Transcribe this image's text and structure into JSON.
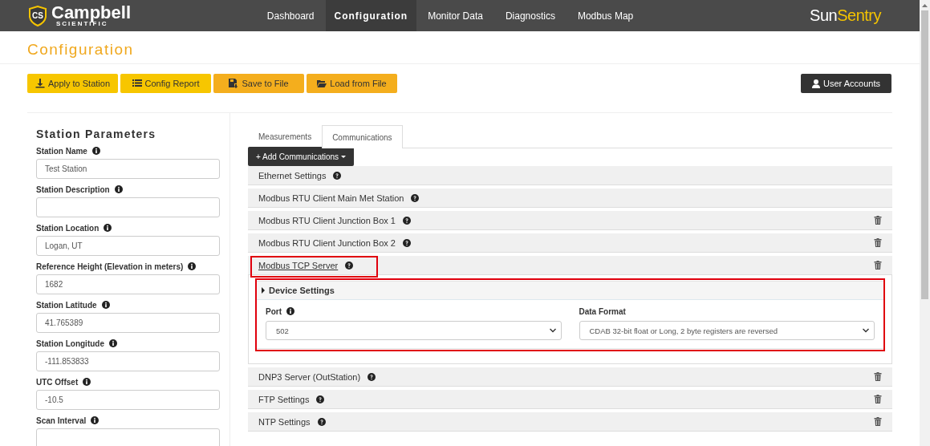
{
  "nav": {
    "logo_mark": "CS",
    "logo": "Campbell",
    "logo_sub": "SCIENTIFIC",
    "brand_left": "Sun",
    "brand_right": "Sentry",
    "items": [
      {
        "label": "Dashboard",
        "selected": false
      },
      {
        "label": "Configuration",
        "selected": true
      },
      {
        "label": "Monitor Data",
        "selected": false
      },
      {
        "label": "Diagnostics",
        "selected": false
      },
      {
        "label": "Modbus Map",
        "selected": false
      }
    ]
  },
  "page_title": "Configuration",
  "toolbar": [
    {
      "label": "Apply to Station",
      "color": "#f7c600"
    },
    {
      "label": "Config Report",
      "color": "#f7c600"
    },
    {
      "label": "Save to File",
      "color": "#f4ae1d"
    },
    {
      "label": "Load from File",
      "color": "#f4ae1d"
    }
  ],
  "user_button": "User Accounts",
  "sidebar": {
    "title": "Station Parameters",
    "fields": [
      {
        "label": "Station Name",
        "value": "Test Station"
      },
      {
        "label": "Station Description"
      },
      {
        "label": "Station Location",
        "value": "Logan, UT"
      },
      {
        "label": "Reference Height (Elevation in meters)",
        "value": "1682"
      },
      {
        "label": "Station Latitude",
        "value": "41.765389"
      },
      {
        "label": "Station Longitude",
        "value": "-111.853833"
      },
      {
        "label": "UTC Offset",
        "value": "-10.5"
      },
      {
        "label": "Scan Interval"
      }
    ]
  },
  "tabs": [
    {
      "label": "Measurements",
      "selected": false
    },
    {
      "label": "Communications",
      "selected": true
    }
  ],
  "add_button": "+ Add Communications",
  "sections": [
    {
      "title": "Ethernet Settings",
      "expanded": false,
      "deletable": false,
      "highlighted": false
    },
    {
      "title": "Modbus RTU Client Main Met Station",
      "expanded": false,
      "deletable": false,
      "highlighted": false
    },
    {
      "title": "Modbus RTU Client Junction Box 1",
      "expanded": false,
      "deletable": true,
      "highlighted": false
    },
    {
      "title": "Modbus RTU Client Junction Box 2",
      "expanded": false,
      "deletable": true,
      "highlighted": false
    },
    {
      "title": "Modbus TCP Server",
      "expanded": true,
      "deletable": true,
      "highlighted": true,
      "subsections": [
        {
          "title": "Device Settings",
          "highlighted": true,
          "fields": [
            {
              "label": "Port",
              "info": true,
              "value": "502"
            },
            {
              "label": "Data Format",
              "info": false,
              "value": "CDAB 32-bit float or Long, 2 byte registers are reversed"
            }
          ]
        }
      ]
    },
    {
      "title": "DNP3 Server (OutStation)",
      "expanded": false,
      "deletable": true,
      "highlighted": false
    },
    {
      "title": "FTP Settings",
      "expanded": false,
      "deletable": true,
      "highlighted": false
    },
    {
      "title": "NTP Settings",
      "expanded": false,
      "deletable": true,
      "highlighted": false
    }
  ]
}
